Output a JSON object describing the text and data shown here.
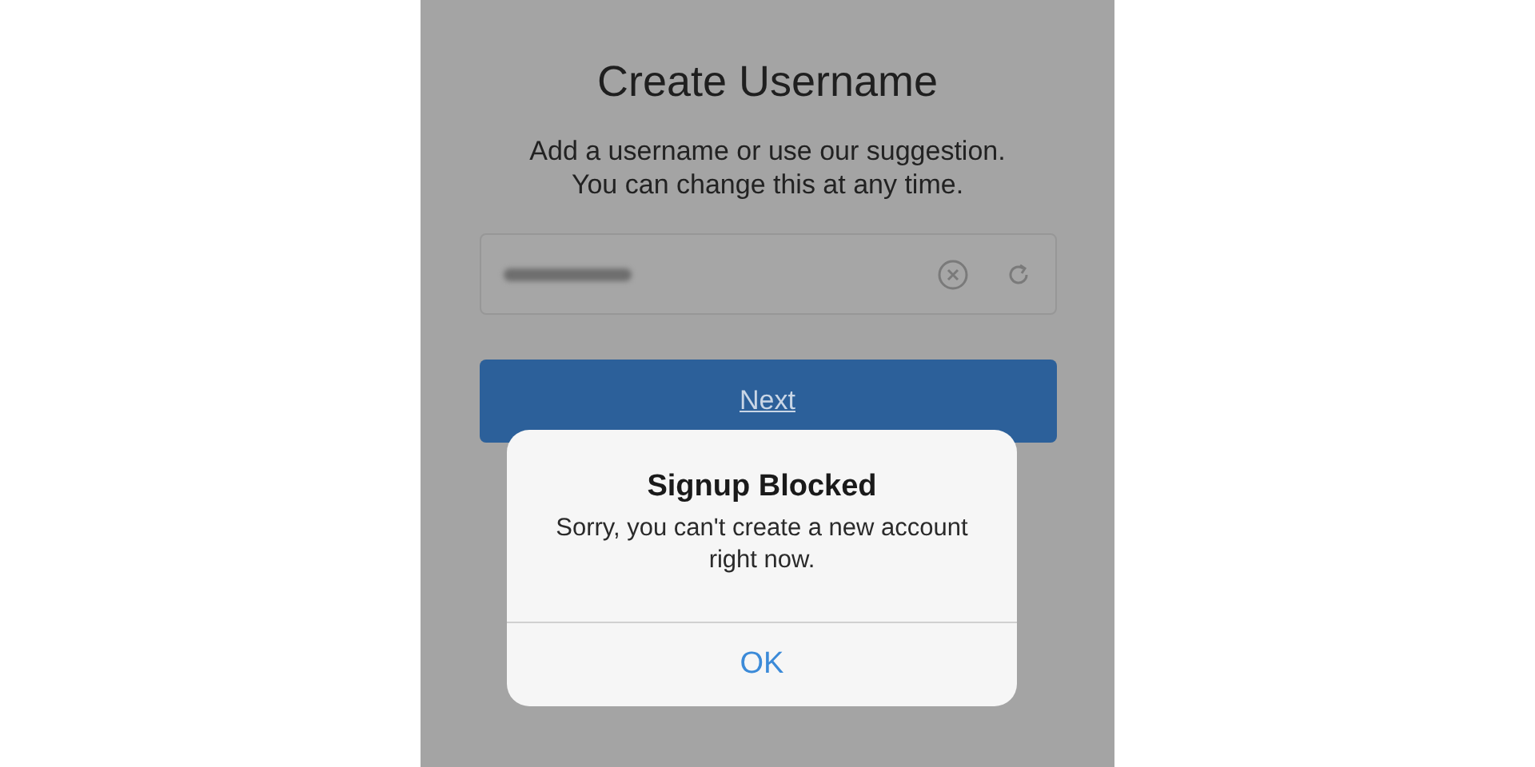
{
  "screen": {
    "title": "Create Username",
    "subtitle_lines": [
      "Add a username or use our suggestion.",
      "You can change this at any time."
    ],
    "next_button": "Next"
  },
  "alert": {
    "title": "Signup Blocked",
    "message": "Sorry, you can't create a new account right now.",
    "button": "OK"
  }
}
